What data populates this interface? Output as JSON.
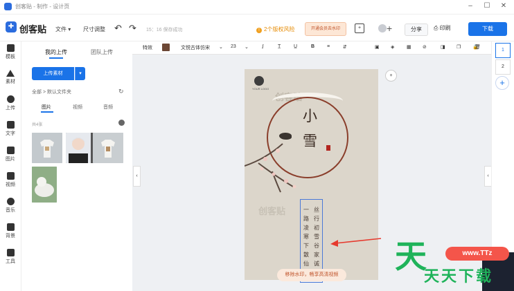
{
  "window": {
    "title": "创客贴 - 制作 - 设计页"
  },
  "toolbar": {
    "brand": "创客贴",
    "file_menu": "文件 ▾",
    "resize": "尺寸调整",
    "save_status": "15：16 保存成功",
    "risk": "2个版权风险",
    "vip": "开通会员去水印",
    "share": "分享",
    "print": "印刷",
    "download": "下载"
  },
  "rail": {
    "items": [
      {
        "label": "模板"
      },
      {
        "label": "素材"
      },
      {
        "label": "上传"
      },
      {
        "label": "文字"
      },
      {
        "label": "图片"
      },
      {
        "label": "视频"
      },
      {
        "label": "音乐"
      },
      {
        "label": "背景"
      },
      {
        "label": "工具"
      }
    ]
  },
  "panel": {
    "tab_mine": "我的上传",
    "tab_team": "团队上传",
    "upload_label": "上传素材",
    "breadcrumb": "全部 > 默认文件夹",
    "subtab_img": "图片",
    "subtab_video": "视频",
    "subtab_audio": "音频",
    "count": "共4张"
  },
  "props": {
    "effect": "特效",
    "font": "文悦古体仿宋",
    "size": "23"
  },
  "poster": {
    "logo_text": "YOUR LOGO",
    "watermark": "创客贴",
    "title1": "小",
    "title2": "雪",
    "columns": [
      "一路凌寒下散仙",
      "丝行初雪谷家诚"
    ],
    "remove_watermark": "移除水印，畅享高清视频"
  },
  "pages": {
    "items": [
      "1",
      "2"
    ]
  },
  "overlay": {
    "site": "www.TTz",
    "brand": "天天下载"
  },
  "colors": {
    "accent": "#1a73e8",
    "text_color": "#6b4634"
  }
}
